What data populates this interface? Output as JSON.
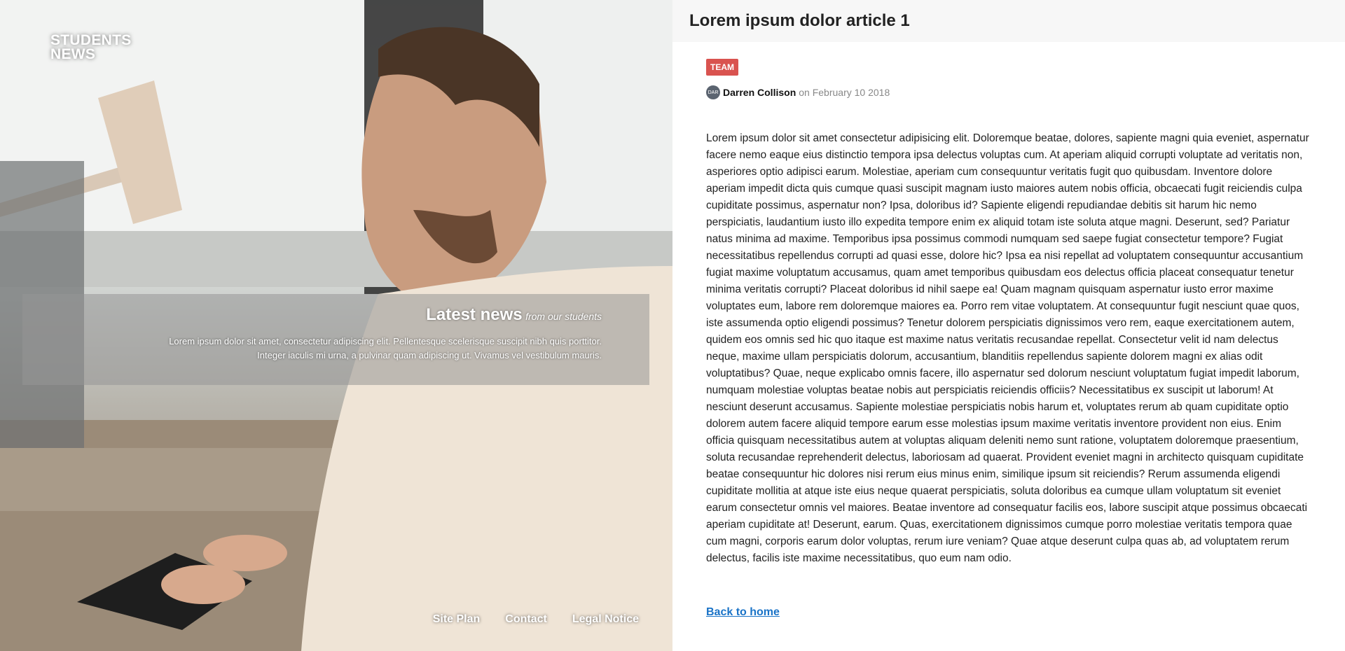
{
  "hero": {
    "logo_line1": "STUDENTS",
    "logo_line2": "NEWS",
    "news_title": "Latest news",
    "news_subtitle": "from our students",
    "news_line1": "Lorem ipsum dolor sit amet, consectetur adipiscing elit. Pellentesque scelerisque suscipit nibh quis porttitor.",
    "news_line2": "Integer iaculis mi urna, a pulvinar quam adipiscing ut. Vivamus vel vestibulum mauris."
  },
  "footer_nav": {
    "site_plan": "Site Plan",
    "contact": "Contact",
    "legal_notice": "Legal Notice"
  },
  "article": {
    "title": "Lorem ipsum dolor article 1",
    "tag": "TEAM",
    "avatar_text": "DAR",
    "author": "Darren Collison",
    "date": "on February 10 2018",
    "body": "Lorem ipsum dolor sit amet consectetur adipisicing elit. Doloremque beatae, dolores, sapiente magni quia eveniet, aspernatur facere nemo eaque eius distinctio tempora ipsa delectus voluptas cum. At aperiam aliquid corrupti voluptate ad veritatis non, asperiores optio adipisci earum. Molestiae, aperiam cum consequuntur veritatis fugit quo quibusdam. Inventore dolore aperiam impedit dicta quis cumque quasi suscipit magnam iusto maiores autem nobis officia, obcaecati fugit reiciendis culpa cupiditate possimus, aspernatur non? Ipsa, doloribus id? Sapiente eligendi repudiandae debitis sit harum hic nemo perspiciatis, laudantium iusto illo expedita tempore enim ex aliquid totam iste soluta atque magni. Deserunt, sed? Pariatur natus minima ad maxime. Temporibus ipsa possimus commodi numquam sed saepe fugiat consectetur tempore? Fugiat necessitatibus repellendus corrupti ad quasi esse, dolore hic? Ipsa ea nisi repellat ad voluptatem consequuntur accusantium fugiat maxime voluptatum accusamus, quam amet temporibus quibusdam eos delectus officia placeat consequatur tenetur minima veritatis corrupti? Placeat doloribus id nihil saepe ea! Quam magnam quisquam aspernatur iusto error maxime voluptates eum, labore rem doloremque maiores ea. Porro rem vitae voluptatem. At consequuntur fugit nesciunt quae quos, iste assumenda optio eligendi possimus? Tenetur dolorem perspiciatis dignissimos vero rem, eaque exercitationem autem, quidem eos omnis sed hic quo itaque est maxime natus veritatis recusandae repellat. Consectetur velit id nam delectus neque, maxime ullam perspiciatis dolorum, accusantium, blanditiis repellendus sapiente dolorem magni ex alias odit voluptatibus? Quae, neque explicabo omnis facere, illo aspernatur sed dolorum nesciunt voluptatum fugiat impedit laborum, numquam molestiae voluptas beatae nobis aut perspiciatis reiciendis officiis? Necessitatibus ex suscipit ut laborum! At nesciunt deserunt accusamus. Sapiente molestiae perspiciatis nobis harum et, voluptates rerum ab quam cupiditate optio dolorem autem facere aliquid tempore earum esse molestias ipsum maxime veritatis inventore provident non eius. Enim officia quisquam necessitatibus autem at voluptas aliquam deleniti nemo sunt ratione, voluptatem doloremque praesentium, soluta recusandae reprehenderit delectus, laboriosam ad quaerat. Provident eveniet magni in architecto quisquam cupiditate beatae consequuntur hic dolores nisi rerum eius minus enim, similique ipsum sit reiciendis? Rerum assumenda eligendi cupiditate mollitia at atque iste eius neque quaerat perspiciatis, soluta doloribus ea cumque ullam voluptatum sit eveniet earum consectetur omnis vel maiores. Beatae inventore ad consequatur facilis eos, labore suscipit atque possimus obcaecati aperiam cupiditate at! Deserunt, earum. Quas, exercitationem dignissimos cumque porro molestiae veritatis tempora quae cum magni, corporis earum dolor voluptas, rerum iure veniam? Quae atque deserunt culpa quas ab, ad voluptatem rerum delectus, facilis iste maxime necessitatibus, quo eum nam odio.",
    "back_link": "Back to home"
  }
}
